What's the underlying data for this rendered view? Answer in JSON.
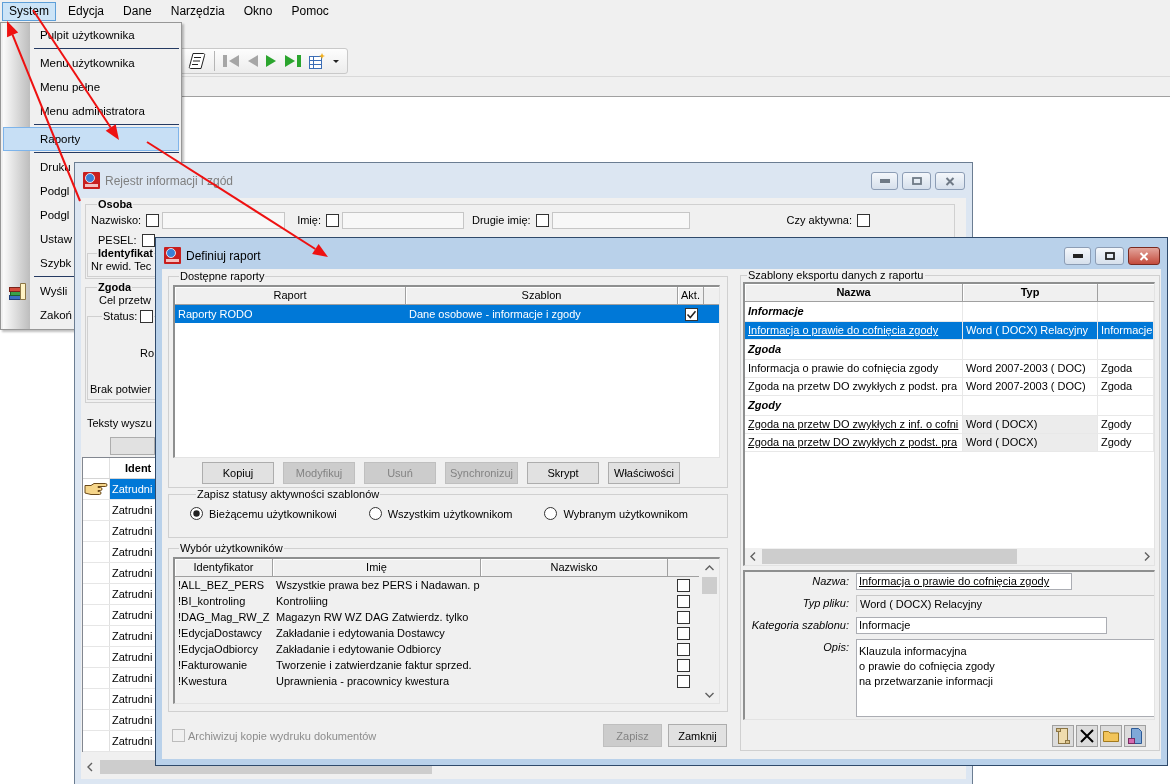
{
  "app": {
    "menu_bar": [
      {
        "label": "System",
        "selected": true
      },
      {
        "label": "Edycja",
        "selected": false
      },
      {
        "label": "Dane",
        "selected": false
      },
      {
        "label": "Narzędzia",
        "selected": false
      },
      {
        "label": "Okno",
        "selected": false
      },
      {
        "label": "Pomoc",
        "selected": false
      }
    ],
    "toolbar": [
      {
        "kind": "script",
        "disabled": false
      },
      {
        "kind": "first",
        "disabled": true
      },
      {
        "kind": "previous",
        "disabled": true
      },
      {
        "kind": "next",
        "disabled": false
      },
      {
        "kind": "last",
        "disabled": false
      },
      {
        "kind": "table",
        "disabled": false
      }
    ],
    "system_menu": [
      {
        "kind": "item",
        "label": "Pulpit użytkownika",
        "selected": false
      },
      {
        "kind": "separator"
      },
      {
        "kind": "item",
        "label": "Menu użytkownika",
        "selected": false
      },
      {
        "kind": "item",
        "label": "Menu pełne",
        "selected": false
      },
      {
        "kind": "item",
        "label": "Menu administratora",
        "selected": false
      },
      {
        "kind": "separator"
      },
      {
        "kind": "item",
        "label": "Raporty",
        "selected": true
      },
      {
        "kind": "separator"
      },
      {
        "kind": "item",
        "label": "Druku",
        "selected": false
      },
      {
        "kind": "item",
        "label": "Podgl",
        "selected": false
      },
      {
        "kind": "item",
        "label": "Podgl",
        "selected": false
      },
      {
        "kind": "item",
        "label": "Ustaw",
        "selected": false
      },
      {
        "kind": "item",
        "label": "Szybk",
        "selected": false
      },
      {
        "kind": "separator"
      },
      {
        "kind": "icon_item",
        "label": "Wyśli",
        "selected": false
      },
      {
        "kind": "item",
        "label": "Zakoń",
        "selected": false
      }
    ]
  },
  "register_window": {
    "title": "Rejestr informacji i zgód",
    "active": false,
    "person": {
      "heading": "Osoba",
      "fields": [
        {
          "label": "Nazwisko:",
          "checked": false
        },
        {
          "label": "Imię:",
          "checked": false
        },
        {
          "label": "Drugie imię:",
          "checked": false
        }
      ],
      "active_filter": {
        "label": "Czy aktywna:",
        "checked": false
      },
      "pesel": {
        "label": "PESEL:",
        "checked": false
      },
      "identifier": {
        "heading": "Identyfikat",
        "label": "Nr ewid. Tec"
      }
    },
    "consent": {
      "heading": "Zgoda",
      "purpose_label": "Cel przetw",
      "status": {
        "label": "Status:",
        "checked": false
      },
      "field_label_1": "Ro",
      "field_label_2": "Brak potwier"
    },
    "search_label": "Teksty wyszu",
    "table": {
      "columns": [
        "Ident"
      ],
      "rows": [
        {
          "cells": [
            "Zatrudni"
          ],
          "selected": true
        },
        {
          "cells": [
            "Zatrudni"
          ],
          "selected": false
        },
        {
          "cells": [
            "Zatrudni"
          ],
          "selected": false
        },
        {
          "cells": [
            "Zatrudni"
          ],
          "selected": false
        },
        {
          "cells": [
            "Zatrudni"
          ],
          "selected": false
        },
        {
          "cells": [
            "Zatrudni"
          ],
          "selected": false
        },
        {
          "cells": [
            "Zatrudni"
          ],
          "selected": false
        },
        {
          "cells": [
            "Zatrudni"
          ],
          "selected": false
        },
        {
          "cells": [
            "Zatrudni"
          ],
          "selected": false
        },
        {
          "cells": [
            "Zatrudni"
          ],
          "selected": false
        },
        {
          "cells": [
            "Zatrudni"
          ],
          "selected": false
        },
        {
          "cells": [
            "Zatrudni"
          ],
          "selected": false
        },
        {
          "cells": [
            "Zatrudni"
          ],
          "selected": false
        }
      ]
    }
  },
  "report_dialog": {
    "title": "Definiuj raport",
    "active": true,
    "reports": {
      "title": "Dostępne raporty",
      "columns": [
        "Raport",
        "Szablon",
        "Akt."
      ],
      "rows": [
        {
          "report": "Raporty RODO",
          "template": "Dane osobowe - informacje i zgody",
          "active": true,
          "selected": true
        }
      ]
    },
    "report_buttons": [
      {
        "label": "Kopiuj",
        "disabled": false
      },
      {
        "label": "Modyfikuj",
        "disabled": true
      },
      {
        "label": "Usuń",
        "disabled": true
      },
      {
        "label": "Synchronizuj",
        "disabled": true
      },
      {
        "label": "Skrypt",
        "disabled": false
      },
      {
        "label": "Właściwości",
        "disabled": false
      }
    ],
    "status_scope": {
      "title": "Zapisz statusy aktywności szablonów",
      "options": [
        {
          "label": "Bieżącemu użytkownikowi",
          "selected": true
        },
        {
          "label": "Wszystkim użytkownikom",
          "selected": false
        },
        {
          "label": "Wybranym użytkownikom",
          "selected": false
        }
      ]
    },
    "users": {
      "title": "Wybór użytkowników",
      "columns": [
        "Identyfikator",
        "Imię",
        "Nazwisko"
      ],
      "rows": [
        {
          "id": "!ALL_BEZ_PERS",
          "name": "Wszystkie prawa bez PERS i Nadawan. p",
          "checked": false
        },
        {
          "id": "!BI_kontroling",
          "name": "Kontroliing",
          "checked": false
        },
        {
          "id": "!DAG_Mag_RW_Z",
          "name": "Magazyn RW WZ DAG Zatwierdz. tylko",
          "checked": false
        },
        {
          "id": "!EdycjaDostawcy",
          "name": "Zakładanie i edytowania Dostawcy",
          "checked": false
        },
        {
          "id": "!EdycjaOdbiorcy",
          "name": "Zakładanie i edytowanie Odbiorcy",
          "checked": false
        },
        {
          "id": "!Fakturowanie",
          "name": "Tworzenie i zatwierdzanie faktur sprzed.",
          "checked": false
        },
        {
          "id": "!Kwestura",
          "name": "Uprawnienia - pracownicy kwestura",
          "checked": false
        }
      ]
    },
    "archive": {
      "label": "Archiwizuj kopie wydruku dokumentów",
      "checked": false,
      "disabled": true
    },
    "footer_buttons": [
      {
        "label": "Zapisz",
        "disabled": true
      },
      {
        "label": "Zamknij",
        "disabled": false
      }
    ],
    "templates": {
      "title": "Szablony eksportu danych z raportu",
      "columns": [
        "Nazwa",
        "Typ"
      ],
      "groups": [
        {
          "name": "Informacje",
          "rows": [
            {
              "name": "Informacja o prawie do cofnięcia zgody",
              "type": "Word ( DOCX) Relacyjny",
              "column_3": "Informacje",
              "selected": true,
              "underlined": true,
              "type_shaded": false
            }
          ]
        },
        {
          "name": "Zgoda",
          "rows": [
            {
              "name": "Informacja o prawie do cofnięcia zgody",
              "type": "Word 2007-2003 ( DOC)",
              "column_3": "Zgoda",
              "selected": false,
              "underlined": false,
              "type_shaded": false
            },
            {
              "name": "Zgoda na przetw DO zwykłych z podst. pra",
              "type": "Word 2007-2003 ( DOC)",
              "column_3": "Zgoda",
              "selected": false,
              "underlined": false,
              "type_shaded": false
            }
          ]
        },
        {
          "name": "Zgody",
          "rows": [
            {
              "name": "Zgoda na przetw DO zwykłych z inf. o cofni",
              "type": "Word ( DOCX)",
              "column_3": "Zgody",
              "selected": false,
              "underlined": true,
              "type_shaded": true
            },
            {
              "name": "Zgoda na przetw DO zwykłych z podst. pra",
              "type": "Word ( DOCX)",
              "column_3": "Zgody",
              "selected": false,
              "underlined": true,
              "type_shaded": true
            }
          ]
        }
      ]
    },
    "template_details": [
      {
        "kind": "input",
        "label": "Nazwa:",
        "value": "Informacja o prawie do cofnięcia zgody",
        "underlined": true
      },
      {
        "kind": "readonly",
        "label": "Typ pliku:",
        "value": "Word ( DOCX) Relacyjny"
      },
      {
        "kind": "input",
        "label": "Kategoria szablonu:",
        "value": "Informacje",
        "underlined": false
      },
      {
        "kind": "textarea",
        "label": "Opis:",
        "lines": [
          "Klauzula informacyjna",
          "o prawie do cofnięcia zgody",
          "na przetwarzanie informacji"
        ]
      }
    ]
  }
}
